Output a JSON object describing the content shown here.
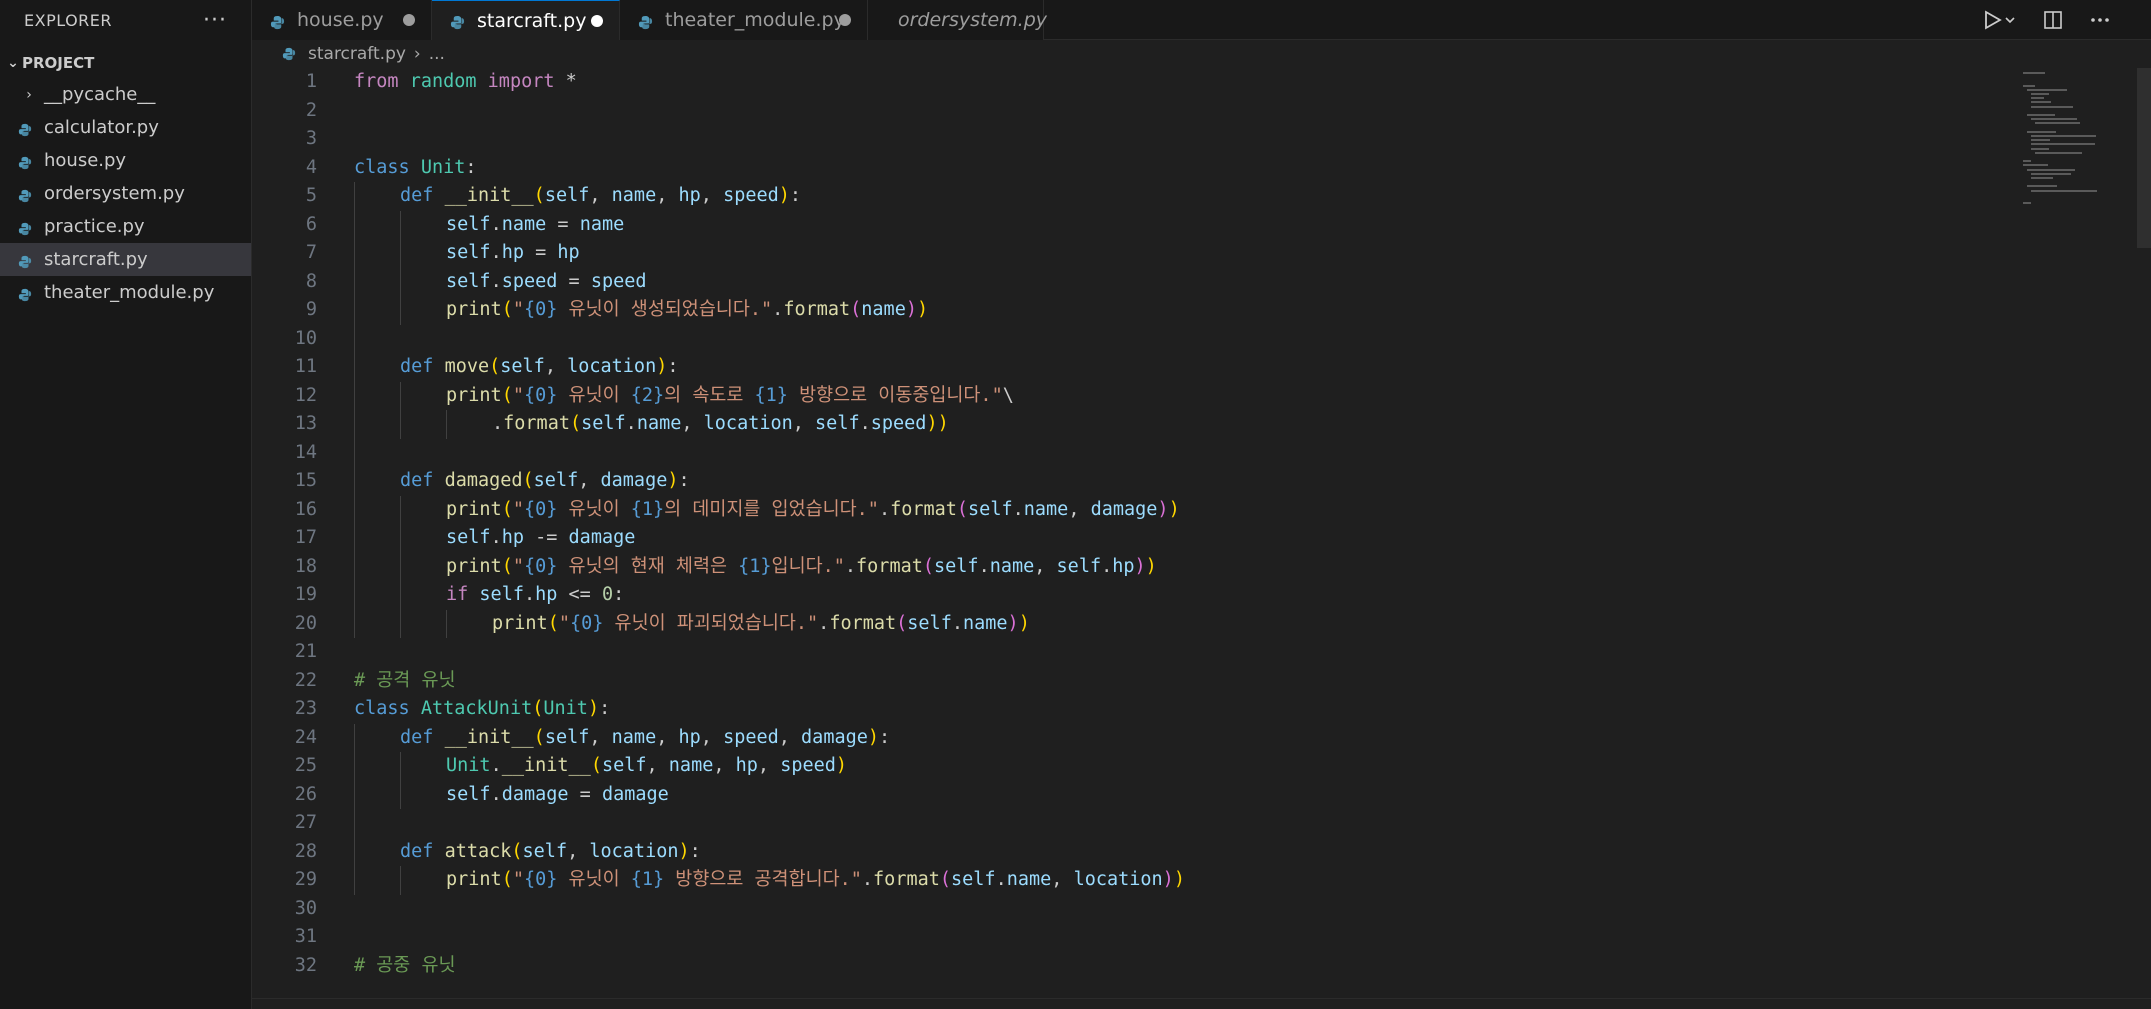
{
  "explorer": {
    "title": "EXPLORER",
    "more_label": "···",
    "project_label": "PROJECT",
    "items": [
      {
        "label": "__pycache__",
        "folder": true
      },
      {
        "label": "calculator.py"
      },
      {
        "label": "house.py"
      },
      {
        "label": "ordersystem.py"
      },
      {
        "label": "practice.py"
      },
      {
        "label": "starcraft.py",
        "selected": true
      },
      {
        "label": "theater_module.py"
      }
    ]
  },
  "tabs": [
    {
      "label": "house.py",
      "dirty": true
    },
    {
      "label": "starcraft.py",
      "dirty": true,
      "active": true
    },
    {
      "label": "theater_module.py",
      "dirty": true
    },
    {
      "label": "ordersystem.py",
      "preview": true
    }
  ],
  "breadcrumb": {
    "file": "starcraft.py",
    "rest": "..."
  },
  "editor": {
    "lines": [
      {
        "n": 1,
        "indent": 0,
        "code": "from random import *"
      },
      {
        "n": 2,
        "indent": 0,
        "code": ""
      },
      {
        "n": 3,
        "indent": 0,
        "code": ""
      },
      {
        "n": 4,
        "indent": 0,
        "code": "class Unit:"
      },
      {
        "n": 5,
        "indent": 1,
        "code": "def __init__(self, name, hp, speed):"
      },
      {
        "n": 6,
        "indent": 2,
        "code": "self.name = name"
      },
      {
        "n": 7,
        "indent": 2,
        "code": "self.hp = hp"
      },
      {
        "n": 8,
        "indent": 2,
        "code": "self.speed = speed"
      },
      {
        "n": 9,
        "indent": 2,
        "code": "print(\"{0} 유닛이 생성되었습니다.\".format(name))"
      },
      {
        "n": 10,
        "indent": 0,
        "code": ""
      },
      {
        "n": 11,
        "indent": 1,
        "code": "def move(self, location):"
      },
      {
        "n": 12,
        "indent": 2,
        "code": "print(\"{0} 유닛이 {2}의 속도로 {1} 방향으로 이동중입니다.\"\\"
      },
      {
        "n": 13,
        "indent": 3,
        "code": ".format(self.name, location, self.speed))"
      },
      {
        "n": 14,
        "indent": 0,
        "code": ""
      },
      {
        "n": 15,
        "indent": 1,
        "code": "def damaged(self, damage):"
      },
      {
        "n": 16,
        "indent": 2,
        "code": "print(\"{0} 유닛이 {1}의 데미지를 입었습니다.\".format(self.name, damage))"
      },
      {
        "n": 17,
        "indent": 2,
        "code": "self.hp -= damage"
      },
      {
        "n": 18,
        "indent": 2,
        "code": "print(\"{0} 유닛의 현재 체력은 {1}입니다.\".format(self.name, self.hp))"
      },
      {
        "n": 19,
        "indent": 2,
        "code": "if self.hp <= 0:"
      },
      {
        "n": 20,
        "indent": 3,
        "code": "print(\"{0} 유닛이 파괴되었습니다.\".format(self.name))"
      },
      {
        "n": 21,
        "indent": 0,
        "code": ""
      },
      {
        "n": 22,
        "indent": 0,
        "code": "# 공격 유닛"
      },
      {
        "n": 23,
        "indent": 0,
        "code": "class AttackUnit(Unit):"
      },
      {
        "n": 24,
        "indent": 1,
        "code": "def __init__(self, name, hp, speed, damage):"
      },
      {
        "n": 25,
        "indent": 2,
        "code": "Unit.__init__(self, name, hp, speed)"
      },
      {
        "n": 26,
        "indent": 2,
        "code": "self.damage = damage"
      },
      {
        "n": 27,
        "indent": 0,
        "code": ""
      },
      {
        "n": 28,
        "indent": 1,
        "code": "def attack(self, location):"
      },
      {
        "n": 29,
        "indent": 2,
        "code": "print(\"{0} 유닛이 {1} 방향으로 공격합니다.\".format(self.name, location))"
      },
      {
        "n": 30,
        "indent": 0,
        "code": ""
      },
      {
        "n": 31,
        "indent": 0,
        "code": ""
      },
      {
        "n": 32,
        "indent": 0,
        "code": "# 공중 유닛"
      }
    ]
  },
  "icons": {
    "python": "python-file-icon",
    "run": "run-icon",
    "split": "split-editor-icon",
    "more": "more-actions-icon"
  },
  "colors": {
    "python_icon": "#519aba",
    "active_tab_border": "#0078d4"
  }
}
